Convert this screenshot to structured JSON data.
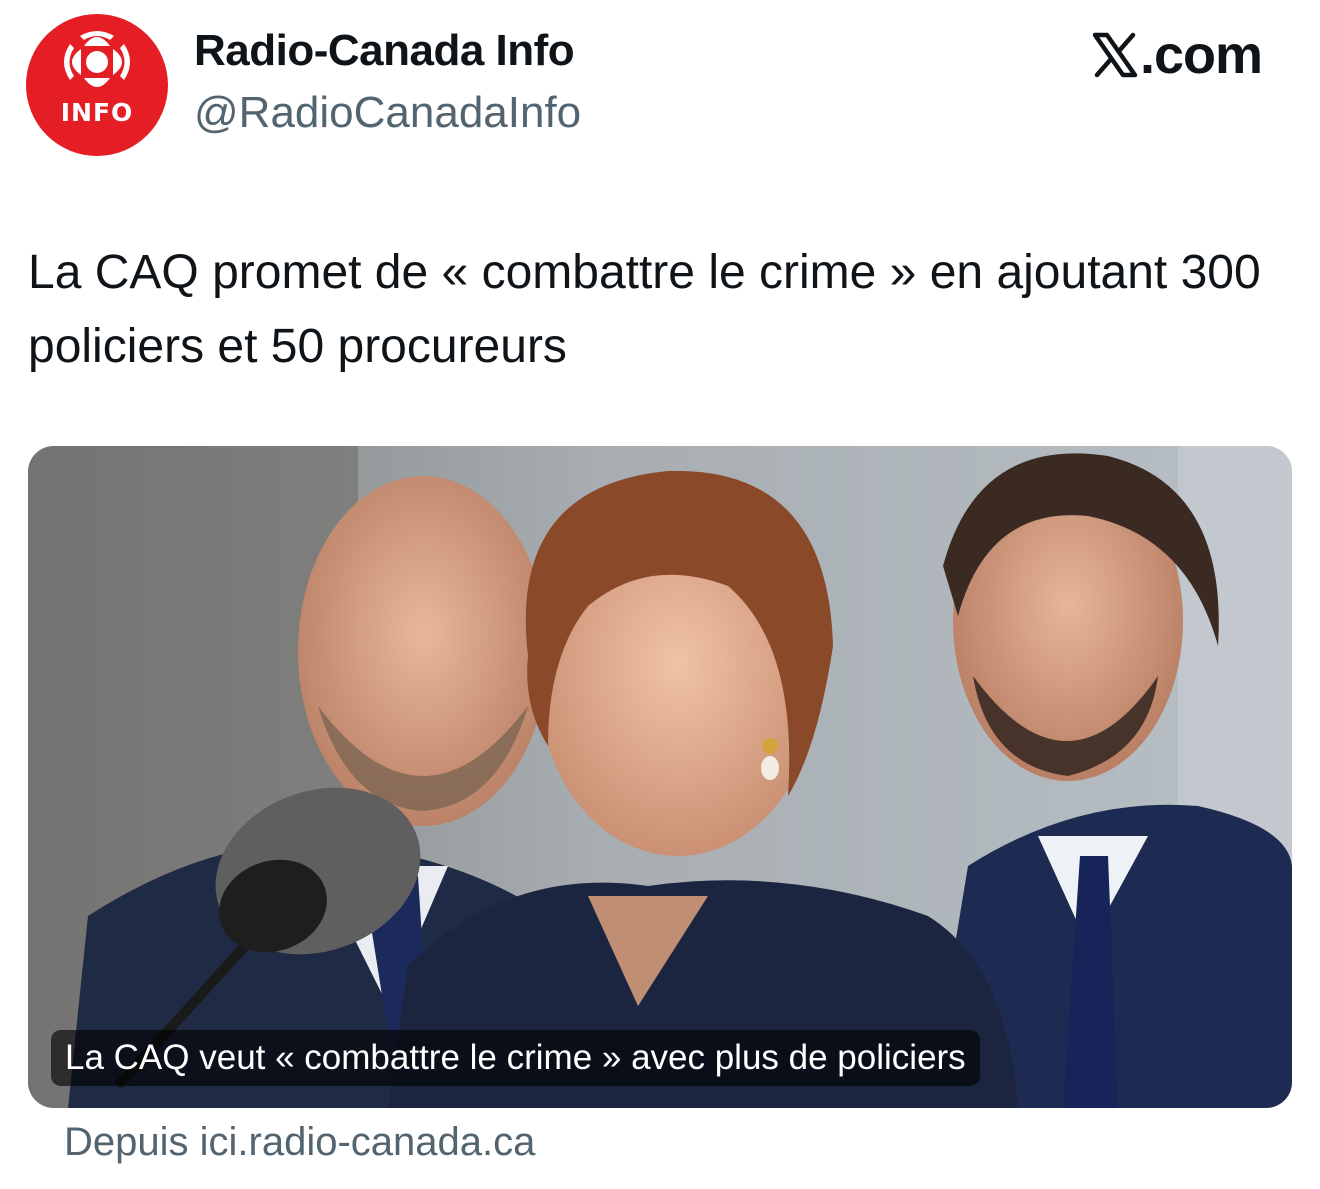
{
  "account": {
    "display_name": "Radio-Canada Info",
    "handle": "@RadioCanadaInfo",
    "avatar_label": "INFO",
    "avatar_color": "#e51e25",
    "avatar_icon": "radio-canada-gem-logo"
  },
  "brand": {
    "label": ".com",
    "icon": "x-logo-icon"
  },
  "tweet": {
    "text": "La CAQ promet de « combattre le crime » en ajoutant 300 policiers et 50 procureurs"
  },
  "link_card": {
    "image_caption": "La CAQ veut « combattre le crime » avec plus de policiers",
    "source": "Depuis ici.radio-canada.ca"
  },
  "colors": {
    "text_primary": "#0f1419",
    "text_secondary": "#536471",
    "accent_red": "#e51e25"
  }
}
